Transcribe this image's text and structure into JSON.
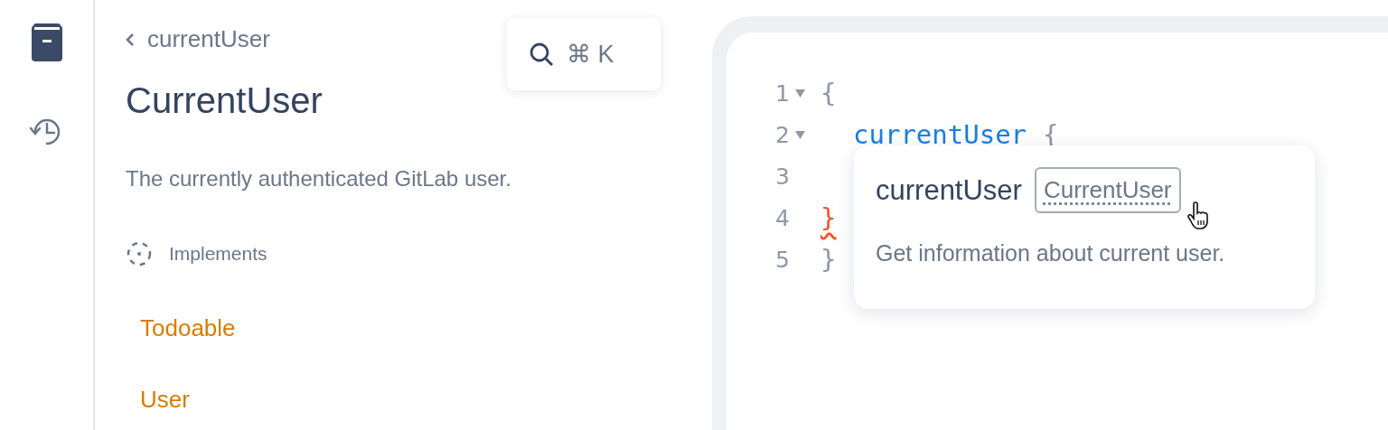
{
  "breadcrumb": {
    "label": "currentUser"
  },
  "title": "CurrentUser",
  "description": "The currently authenticated GitLab user.",
  "implements": {
    "label": "Implements",
    "items": [
      "Todoable",
      "User"
    ]
  },
  "search": {
    "shortcut": "⌘ K"
  },
  "editor": {
    "lines": [
      {
        "number": "1",
        "foldable": true,
        "tokens": [
          {
            "kind": "punct",
            "text": "{"
          }
        ]
      },
      {
        "number": "2",
        "foldable": true,
        "tokens": [
          {
            "kind": "field",
            "text": "currentUser"
          },
          {
            "kind": "punct",
            "text": "{"
          }
        ]
      },
      {
        "number": "3",
        "foldable": false
      },
      {
        "number": "4",
        "foldable": false,
        "tokens": [
          {
            "kind": "error",
            "text": "}"
          }
        ]
      },
      {
        "number": "5",
        "foldable": false,
        "tokens": [
          {
            "kind": "punct",
            "text": "}"
          }
        ]
      }
    ]
  },
  "tooltip": {
    "name": "currentUser",
    "type": "CurrentUser",
    "description": "Get information about current user."
  }
}
